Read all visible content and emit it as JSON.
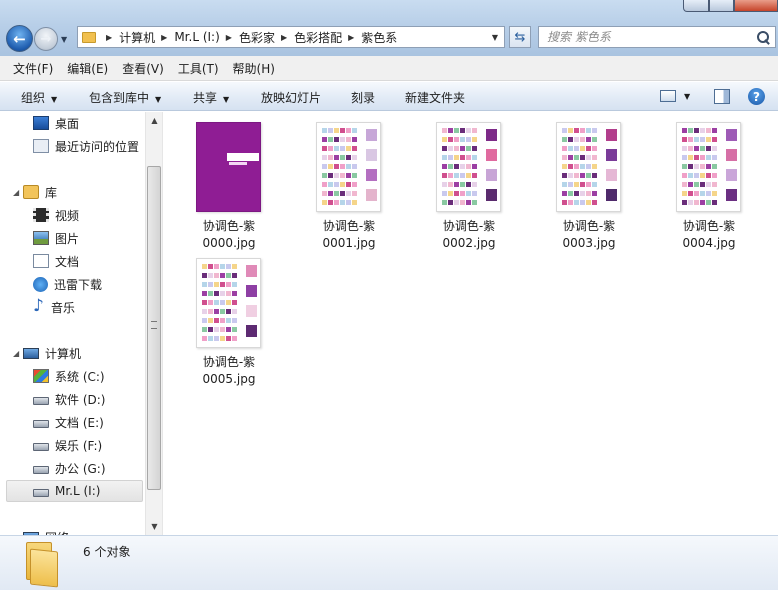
{
  "window": {
    "breadcrumb": [
      "计算机",
      "Mr.L (I:)",
      "色彩家",
      "色彩搭配",
      "紫色系"
    ]
  },
  "search": {
    "placeholder": "搜索 紫色系"
  },
  "menu": [
    "文件(F)",
    "编辑(E)",
    "查看(V)",
    "工具(T)",
    "帮助(H)"
  ],
  "toolbar": {
    "organize": "组织",
    "include_in_library": "包含到库中",
    "share": "共享",
    "slideshow": "放映幻灯片",
    "burn": "刻录",
    "new_folder": "新建文件夹"
  },
  "nav": {
    "favorites": [
      "桌面",
      "最近访问的位置"
    ],
    "libraries_header": "库",
    "libraries": [
      "视频",
      "图片",
      "文档",
      "迅雷下载",
      "音乐"
    ],
    "computer_header": "计算机",
    "drives": [
      "系统 (C:)",
      "软件 (D:)",
      "文档 (E:)",
      "娱乐 (F:)",
      "办公 (G:)",
      "Mr.L (I:)"
    ],
    "network_header": "网络"
  },
  "files": [
    {
      "line1": "协调色-紫",
      "line2": "0000.jpg",
      "thumb": "cover"
    },
    {
      "line1": "协调色-紫",
      "line2": "0001.jpg",
      "thumb": "palette"
    },
    {
      "line1": "协调色-紫",
      "line2": "0002.jpg",
      "thumb": "palette"
    },
    {
      "line1": "协调色-紫",
      "line2": "0003.jpg",
      "thumb": "palette"
    },
    {
      "line1": "协调色-紫",
      "line2": "0004.jpg",
      "thumb": "palette"
    },
    {
      "line1": "协调色-紫",
      "line2": "0005.jpg",
      "thumb": "palette"
    }
  ],
  "status": {
    "count": "6 个对象"
  },
  "icons": {
    "back": "back-arrow-icon",
    "forward": "forward-arrow-icon",
    "refresh": "refresh-icon",
    "search": "search-icon",
    "help": "help-icon",
    "folder": "folder-icon"
  },
  "colors": {
    "accent_purple": "#8f1d94",
    "toolbar_blue": "#dbe6f4"
  }
}
